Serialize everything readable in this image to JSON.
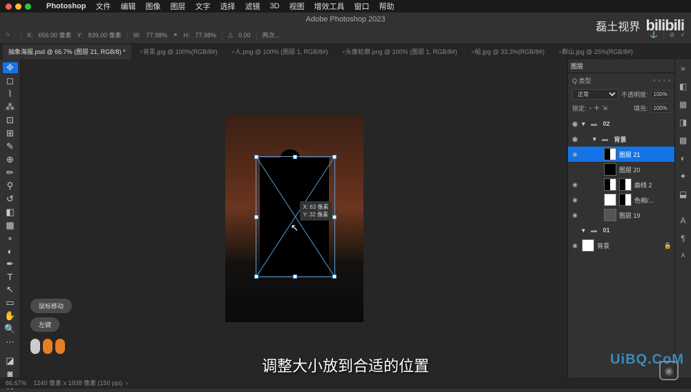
{
  "mac": {
    "app": "Photoshop",
    "menus": [
      "文件",
      "编辑",
      "图像",
      "图层",
      "文字",
      "选择",
      "滤镜",
      "3D",
      "视图",
      "增效工具",
      "窗口",
      "帮助"
    ]
  },
  "title": "Adobe Photoshop 2023",
  "opt": {
    "x_label": "X:",
    "x_val": "656.00 像素",
    "y_label": "Y:",
    "y_val": "839.00 像素",
    "w_label": "W:",
    "w_val": "77.98%",
    "h_label": "H:",
    "h_val": "77.98%",
    "angle_label": "△",
    "angle_val": "0.00",
    "interp": "两次..."
  },
  "tabs": [
    {
      "label": "抽象海报.psd @ 66.7% (图层 21, RGB/8) *",
      "active": true
    },
    {
      "label": "背景.jpg @ 100%(RGB/8#)",
      "active": false
    },
    {
      "label": "人.png @ 100% (图层 1, RGB/8#)",
      "active": false
    },
    {
      "label": "头像轮廓.png @ 100% (图层 1, RGB/8#)",
      "active": false
    },
    {
      "label": "船.jpg @ 33.3%(RGB/8#)",
      "active": false
    },
    {
      "label": "群山.jpg @ 25%(RGB/8#)",
      "active": false
    }
  ],
  "tooltip": "X: 63 像素\nY: 32 像素",
  "panel": {
    "tabs": [
      "图层"
    ],
    "kind": "Q 类型",
    "blend": "正常",
    "opacity_label": "不透明度:",
    "opacity": "100%",
    "lock_label": "锁定:",
    "fill_label": "填充:",
    "fill": "100%"
  },
  "layers": [
    {
      "eye": true,
      "type": "group",
      "name": "02",
      "indent": 0
    },
    {
      "eye": true,
      "type": "group",
      "name": "背景",
      "indent": 1
    },
    {
      "eye": true,
      "type": "layer",
      "name": "图层 21",
      "indent": 2,
      "sel": true,
      "thumb": "mask"
    },
    {
      "eye": false,
      "type": "layer",
      "name": "图层 20",
      "indent": 2,
      "thumb": "black"
    },
    {
      "eye": true,
      "type": "adj",
      "name": "曲线 2",
      "indent": 2,
      "thumb": "mask"
    },
    {
      "eye": true,
      "type": "adj",
      "name": "色相/...",
      "indent": 2,
      "thumb": "white"
    },
    {
      "eye": true,
      "type": "layer",
      "name": "图层 19",
      "indent": 2,
      "thumb": "img"
    },
    {
      "eye": false,
      "type": "group",
      "name": "01",
      "indent": 0
    },
    {
      "eye": true,
      "type": "layer",
      "name": "背景",
      "indent": 0,
      "thumb": "white",
      "lock": true
    }
  ],
  "mouselog": {
    "label1": "鼠标移动",
    "label2": "左键"
  },
  "status": {
    "zoom": "66.67%",
    "dims": "1240 像素 x 1938 像素 (150 ppi)"
  },
  "subtitle": "调整大小放到合适的位置",
  "watermark": {
    "tr1": "磊土视界",
    "tr2": "bilibili",
    "br": "UiBQ.CoM"
  },
  "icons": {
    "home": "⌂",
    "commit": "✓",
    "cancel": "⊘",
    "search": "○"
  }
}
